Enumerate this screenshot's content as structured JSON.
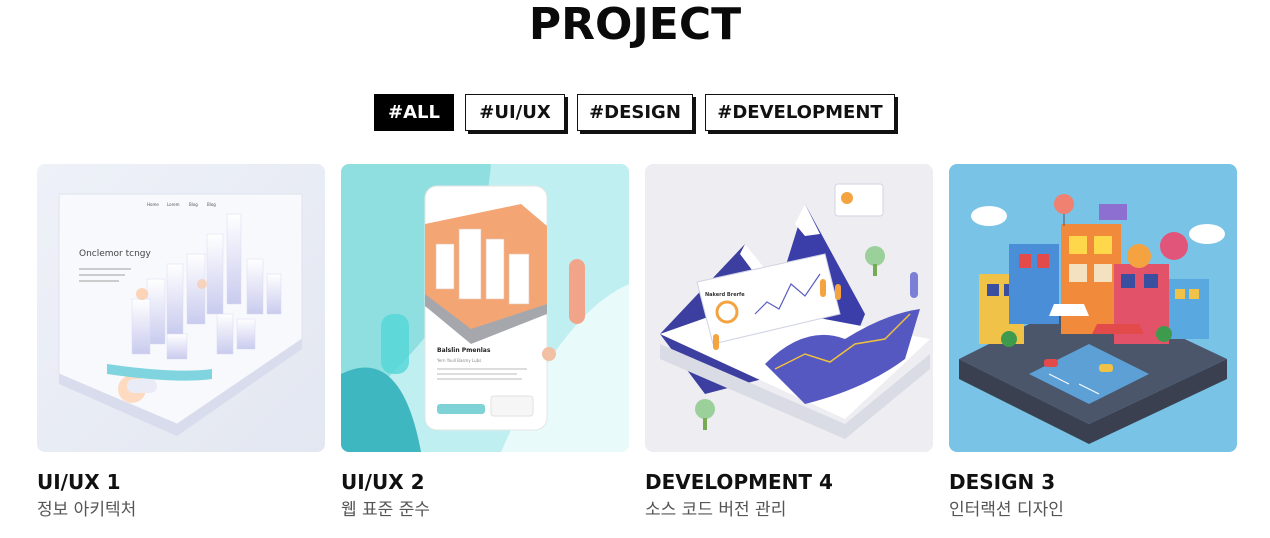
{
  "page": {
    "title": "PROJECT"
  },
  "filters": [
    {
      "label": "#ALL",
      "active": true
    },
    {
      "label": "#UI/UX",
      "active": false
    },
    {
      "label": "#DESIGN",
      "active": false
    },
    {
      "label": "#DEVELOPMENT",
      "active": false
    }
  ],
  "projects": [
    {
      "title": "UI/UX 1",
      "subtitle": "정보 아키텍처",
      "thumb_text": {
        "headline": "Onclemor tcngy",
        "nav": [
          "Home",
          "Lorem",
          "Blog",
          "Blog"
        ]
      }
    },
    {
      "title": "UI/UX 2",
      "subtitle": "웹 표준 준수",
      "thumb_text": {
        "headline": "Balslin Pmenlas",
        "sub": "Yern Youll Basmy Lubs"
      }
    },
    {
      "title": "DEVELOPMENT 4",
      "subtitle": "소스 코드 버전 관리",
      "thumb_text": {
        "panel": "Nakerd Brerfe"
      }
    },
    {
      "title": "DESIGN 3",
      "subtitle": "인터랙션 디자인",
      "thumb_text": {}
    }
  ]
}
